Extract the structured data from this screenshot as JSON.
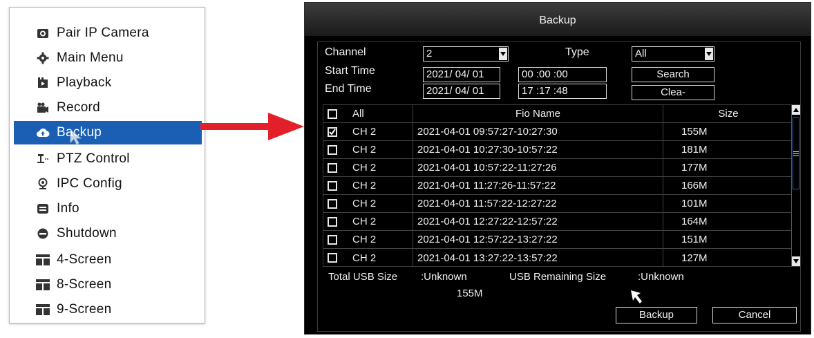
{
  "menu": {
    "items": [
      {
        "label": "Pair IP Camera",
        "icon": "camera-icon"
      },
      {
        "label": "Main Menu",
        "icon": "gear-icon"
      },
      {
        "label": "Playback",
        "icon": "playback-icon"
      },
      {
        "label": "Record",
        "icon": "record-icon"
      },
      {
        "label": "Backup",
        "icon": "cloud-upload-icon",
        "active": true
      },
      {
        "label": "PTZ Control",
        "icon": "ptz-icon"
      },
      {
        "label": "IPC Config",
        "icon": "ipc-icon"
      },
      {
        "label": "Info",
        "icon": "info-icon"
      },
      {
        "label": "Shutdown",
        "icon": "shutdown-icon"
      },
      {
        "label": "4-Screen",
        "icon": "grid-icon"
      },
      {
        "label": "8-Screen",
        "icon": "grid-icon"
      },
      {
        "label": "9-Screen",
        "icon": "grid-icon"
      }
    ]
  },
  "dialog": {
    "title": "Backup",
    "channel_label": "Channel",
    "channel_value": "2",
    "type_label": "Type",
    "type_value": "All",
    "start_label": "Start Time",
    "start_date": "2021/ 04/ 01",
    "start_time": "00 :00 :00",
    "end_label": "End Time",
    "end_date": "2021/ 04/ 01",
    "end_time": "17 :17 :48",
    "search_label": "Search",
    "clear_label": "Clea-",
    "table": {
      "col_all": "All",
      "col_file": "Fio Name",
      "col_size": "Size",
      "rows": [
        {
          "channel": "CH 2",
          "file": "2021-04-01 09:57:27-10:27:30",
          "size": "155M",
          "checked": true
        },
        {
          "channel": "CH 2",
          "file": "2021-04-01 10:27:30-10:57:22",
          "size": "181M",
          "checked": false
        },
        {
          "channel": "CH 2",
          "file": "2021-04-01 10:57:22-11:27:26",
          "size": "177M",
          "checked": false
        },
        {
          "channel": "CH 2",
          "file": "2021-04-01 11:27:26-11:57:22",
          "size": "166M",
          "checked": false
        },
        {
          "channel": "CH 2",
          "file": "2021-04-01 11:57:22-12:27:22",
          "size": "101M",
          "checked": false
        },
        {
          "channel": "CH 2",
          "file": "2021-04-01 12:27:22-12:57:22",
          "size": "164M",
          "checked": false
        },
        {
          "channel": "CH 2",
          "file": "2021-04-01 12:57:22-13:27:22",
          "size": "151M",
          "checked": false
        },
        {
          "channel": "CH 2",
          "file": "2021-04-01 13:27:22-13:57:22",
          "size": "127M",
          "checked": false
        }
      ]
    },
    "total_usb_label": "Total USB Size",
    "total_usb_value": ":Unknown",
    "remaining_label": "USB Remaining Size",
    "remaining_value": ":Unknown",
    "selected_size": "155M",
    "backup_button": "Backup",
    "cancel_button": "Cancel"
  },
  "colors": {
    "menu_active": "#1a5fb4",
    "arrow": "#e3202a",
    "dialog_bg": "#000000",
    "scroll_accent": "#2c5db0"
  }
}
